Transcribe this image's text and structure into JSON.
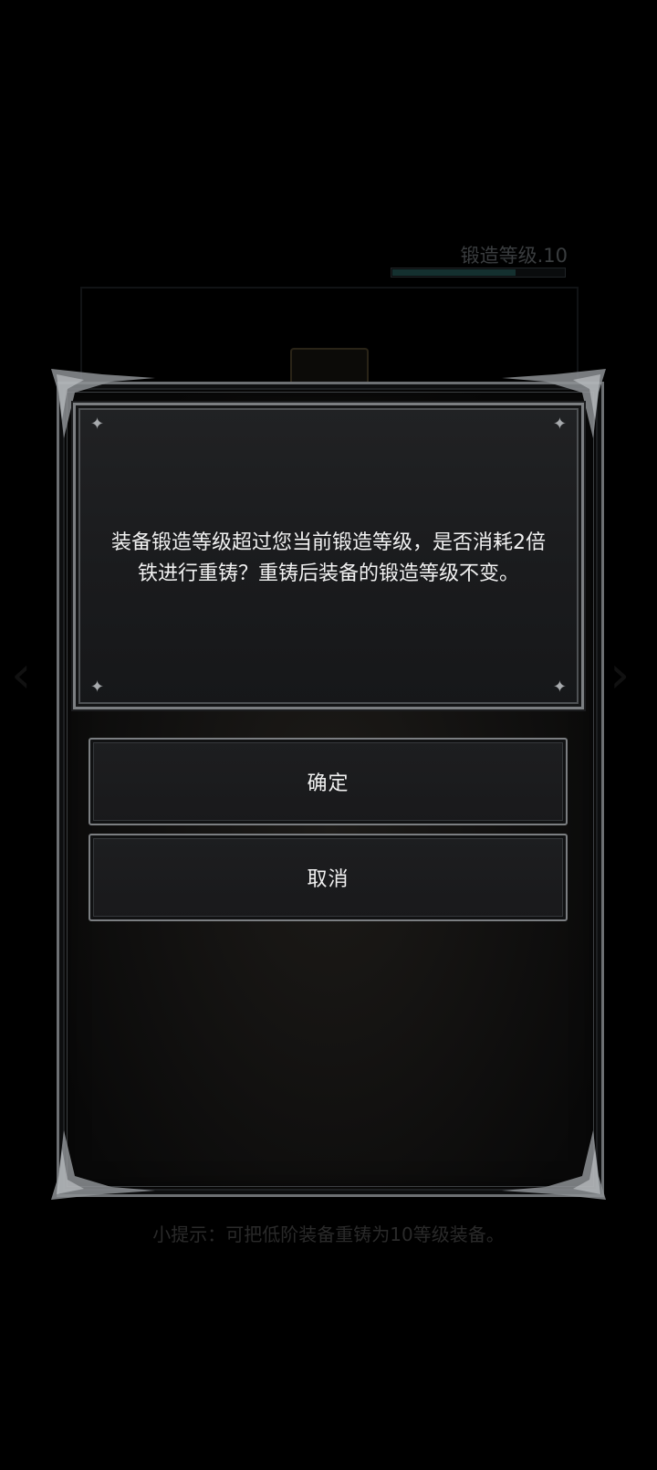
{
  "background": {
    "forge_level_label": "锻造等级.10",
    "forge_progress_fraction": 0.72,
    "tip_text": "小提示：可把低阶装备重铸为10等级装备。",
    "nav_left_icon": "chevron-left",
    "nav_right_icon": "chevron-right"
  },
  "dialog": {
    "message": "装备锻造等级超过您当前锻造等级，是否消耗2倍铁进行重铸？重铸后装备的锻造等级不变。",
    "confirm_label": "确定",
    "cancel_label": "取消",
    "corner_glyph": "✦"
  },
  "colors": {
    "frame": "#7c7f82",
    "text": "#f1f1f1",
    "progress_fill": "#14302f"
  }
}
